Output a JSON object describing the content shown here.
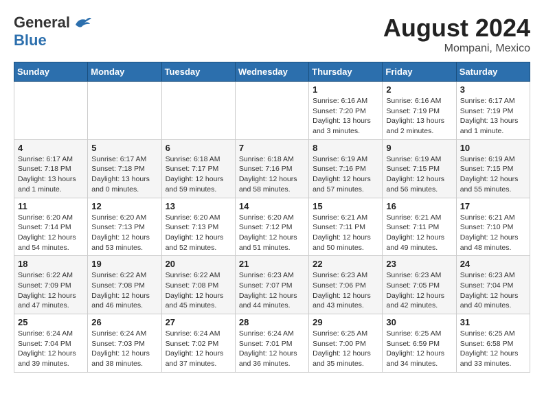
{
  "header": {
    "logo_general": "General",
    "logo_blue": "Blue",
    "month_year": "August 2024",
    "location": "Mompani, Mexico"
  },
  "weekdays": [
    "Sunday",
    "Monday",
    "Tuesday",
    "Wednesday",
    "Thursday",
    "Friday",
    "Saturday"
  ],
  "weeks": [
    [
      {
        "day": "",
        "info": ""
      },
      {
        "day": "",
        "info": ""
      },
      {
        "day": "",
        "info": ""
      },
      {
        "day": "",
        "info": ""
      },
      {
        "day": "1",
        "info": "Sunrise: 6:16 AM\nSunset: 7:20 PM\nDaylight: 13 hours\nand 3 minutes."
      },
      {
        "day": "2",
        "info": "Sunrise: 6:16 AM\nSunset: 7:19 PM\nDaylight: 13 hours\nand 2 minutes."
      },
      {
        "day": "3",
        "info": "Sunrise: 6:17 AM\nSunset: 7:19 PM\nDaylight: 13 hours\nand 1 minute."
      }
    ],
    [
      {
        "day": "4",
        "info": "Sunrise: 6:17 AM\nSunset: 7:18 PM\nDaylight: 13 hours\nand 1 minute."
      },
      {
        "day": "5",
        "info": "Sunrise: 6:17 AM\nSunset: 7:18 PM\nDaylight: 13 hours\nand 0 minutes."
      },
      {
        "day": "6",
        "info": "Sunrise: 6:18 AM\nSunset: 7:17 PM\nDaylight: 12 hours\nand 59 minutes."
      },
      {
        "day": "7",
        "info": "Sunrise: 6:18 AM\nSunset: 7:16 PM\nDaylight: 12 hours\nand 58 minutes."
      },
      {
        "day": "8",
        "info": "Sunrise: 6:19 AM\nSunset: 7:16 PM\nDaylight: 12 hours\nand 57 minutes."
      },
      {
        "day": "9",
        "info": "Sunrise: 6:19 AM\nSunset: 7:15 PM\nDaylight: 12 hours\nand 56 minutes."
      },
      {
        "day": "10",
        "info": "Sunrise: 6:19 AM\nSunset: 7:15 PM\nDaylight: 12 hours\nand 55 minutes."
      }
    ],
    [
      {
        "day": "11",
        "info": "Sunrise: 6:20 AM\nSunset: 7:14 PM\nDaylight: 12 hours\nand 54 minutes."
      },
      {
        "day": "12",
        "info": "Sunrise: 6:20 AM\nSunset: 7:13 PM\nDaylight: 12 hours\nand 53 minutes."
      },
      {
        "day": "13",
        "info": "Sunrise: 6:20 AM\nSunset: 7:13 PM\nDaylight: 12 hours\nand 52 minutes."
      },
      {
        "day": "14",
        "info": "Sunrise: 6:20 AM\nSunset: 7:12 PM\nDaylight: 12 hours\nand 51 minutes."
      },
      {
        "day": "15",
        "info": "Sunrise: 6:21 AM\nSunset: 7:11 PM\nDaylight: 12 hours\nand 50 minutes."
      },
      {
        "day": "16",
        "info": "Sunrise: 6:21 AM\nSunset: 7:11 PM\nDaylight: 12 hours\nand 49 minutes."
      },
      {
        "day": "17",
        "info": "Sunrise: 6:21 AM\nSunset: 7:10 PM\nDaylight: 12 hours\nand 48 minutes."
      }
    ],
    [
      {
        "day": "18",
        "info": "Sunrise: 6:22 AM\nSunset: 7:09 PM\nDaylight: 12 hours\nand 47 minutes."
      },
      {
        "day": "19",
        "info": "Sunrise: 6:22 AM\nSunset: 7:08 PM\nDaylight: 12 hours\nand 46 minutes."
      },
      {
        "day": "20",
        "info": "Sunrise: 6:22 AM\nSunset: 7:08 PM\nDaylight: 12 hours\nand 45 minutes."
      },
      {
        "day": "21",
        "info": "Sunrise: 6:23 AM\nSunset: 7:07 PM\nDaylight: 12 hours\nand 44 minutes."
      },
      {
        "day": "22",
        "info": "Sunrise: 6:23 AM\nSunset: 7:06 PM\nDaylight: 12 hours\nand 43 minutes."
      },
      {
        "day": "23",
        "info": "Sunrise: 6:23 AM\nSunset: 7:05 PM\nDaylight: 12 hours\nand 42 minutes."
      },
      {
        "day": "24",
        "info": "Sunrise: 6:23 AM\nSunset: 7:04 PM\nDaylight: 12 hours\nand 40 minutes."
      }
    ],
    [
      {
        "day": "25",
        "info": "Sunrise: 6:24 AM\nSunset: 7:04 PM\nDaylight: 12 hours\nand 39 minutes."
      },
      {
        "day": "26",
        "info": "Sunrise: 6:24 AM\nSunset: 7:03 PM\nDaylight: 12 hours\nand 38 minutes."
      },
      {
        "day": "27",
        "info": "Sunrise: 6:24 AM\nSunset: 7:02 PM\nDaylight: 12 hours\nand 37 minutes."
      },
      {
        "day": "28",
        "info": "Sunrise: 6:24 AM\nSunset: 7:01 PM\nDaylight: 12 hours\nand 36 minutes."
      },
      {
        "day": "29",
        "info": "Sunrise: 6:25 AM\nSunset: 7:00 PM\nDaylight: 12 hours\nand 35 minutes."
      },
      {
        "day": "30",
        "info": "Sunrise: 6:25 AM\nSunset: 6:59 PM\nDaylight: 12 hours\nand 34 minutes."
      },
      {
        "day": "31",
        "info": "Sunrise: 6:25 AM\nSunset: 6:58 PM\nDaylight: 12 hours\nand 33 minutes."
      }
    ]
  ]
}
